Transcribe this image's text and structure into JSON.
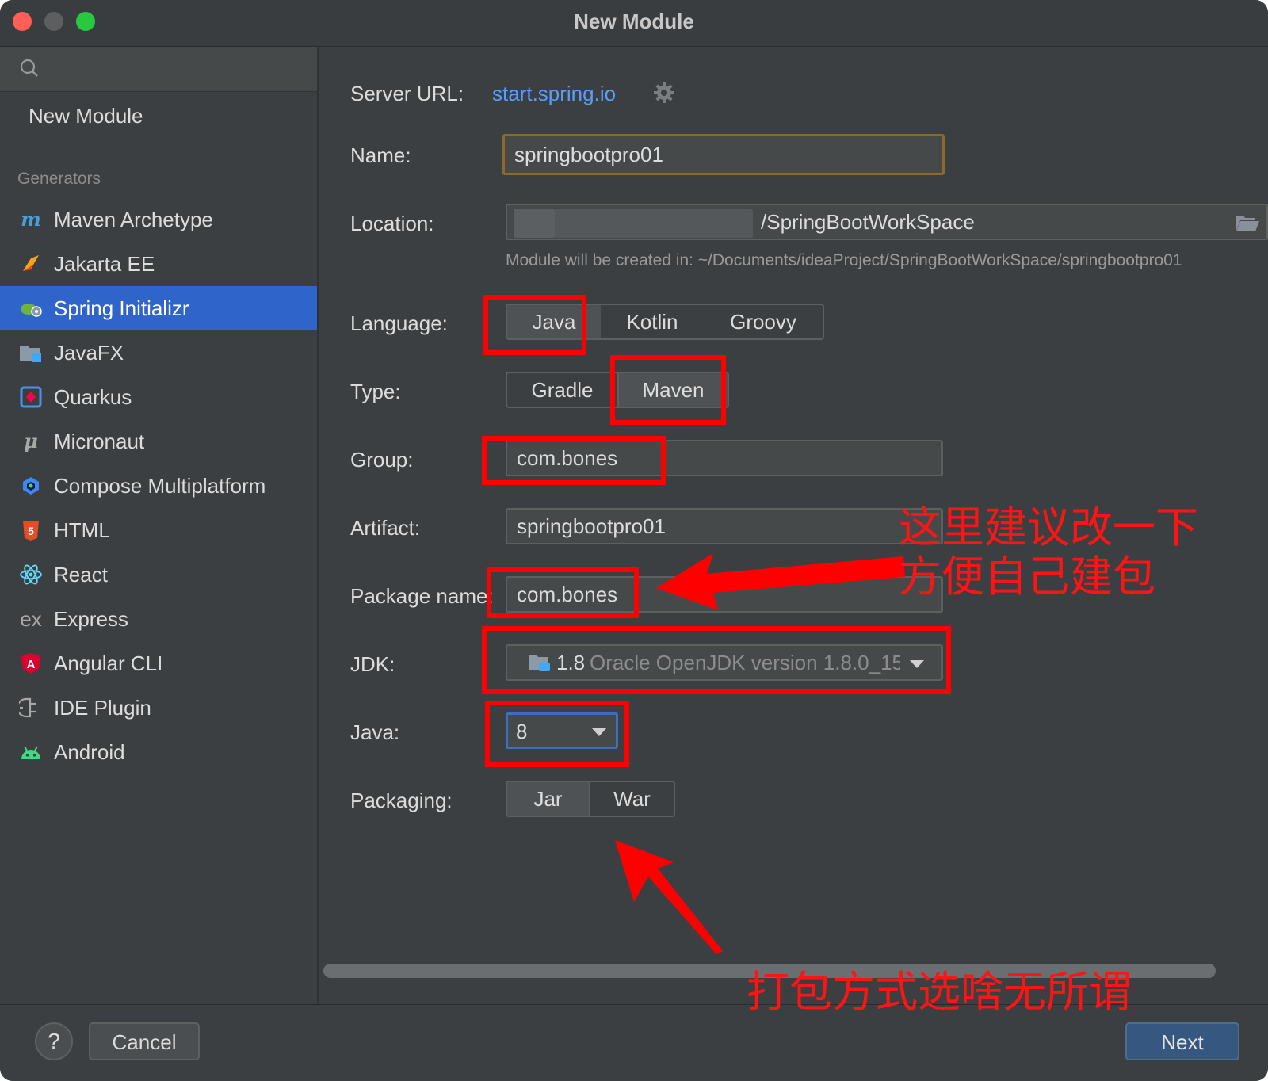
{
  "window": {
    "title": "New Module"
  },
  "sidebar": {
    "new_module": "New Module",
    "generators_label": "Generators",
    "items": [
      {
        "label": "Maven Archetype",
        "icon": "maven-icon"
      },
      {
        "label": "Jakarta EE",
        "icon": "jakarta-ee-icon"
      },
      {
        "label": "Spring Initializr",
        "icon": "spring-icon",
        "selected": true
      },
      {
        "label": "JavaFX",
        "icon": "javafx-icon"
      },
      {
        "label": "Quarkus",
        "icon": "quarkus-icon"
      },
      {
        "label": "Micronaut",
        "icon": "micronaut-icon"
      },
      {
        "label": "Compose Multiplatform",
        "icon": "compose-icon"
      },
      {
        "label": "HTML",
        "icon": "html5-icon"
      },
      {
        "label": "React",
        "icon": "react-icon"
      },
      {
        "label": "Express",
        "icon": "express-icon"
      },
      {
        "label": "Angular CLI",
        "icon": "angular-icon"
      },
      {
        "label": "IDE Plugin",
        "icon": "plugin-icon"
      },
      {
        "label": "Android",
        "icon": "android-icon"
      }
    ]
  },
  "form": {
    "server_url_label": "Server URL:",
    "server_url": "start.spring.io",
    "name_label": "Name:",
    "name_value": "springbootpro01",
    "location_label": "Location:",
    "location_value": "/SpringBootWorkSpace",
    "location_hint": "Module will be created in: ~/Documents/ideaProject/SpringBootWorkSpace/springbootpro01",
    "language_label": "Language:",
    "language_options": [
      "Java",
      "Kotlin",
      "Groovy"
    ],
    "language_selected": "Java",
    "type_label": "Type:",
    "type_options": [
      "Gradle",
      "Maven"
    ],
    "type_selected": "Maven",
    "group_label": "Group:",
    "group_value": "com.bones",
    "artifact_label": "Artifact:",
    "artifact_value": "springbootpro01",
    "package_label": "Package name:",
    "package_value": "com.bones",
    "jdk_label": "JDK:",
    "jdk_version": "1.8",
    "jdk_detail": "Oracle OpenJDK version 1.8.0_15",
    "java_label": "Java:",
    "java_value": "8",
    "packaging_label": "Packaging:",
    "packaging_options": [
      "Jar",
      "War"
    ],
    "packaging_selected": "Jar"
  },
  "annotations": {
    "package_note_line1": "这里建议改一下",
    "package_note_line2": "方便自己建包",
    "packaging_note": "打包方式选啥无所谓",
    "color": "#ff0000"
  },
  "footer": {
    "help": "?",
    "cancel": "Cancel",
    "next": "Next"
  }
}
